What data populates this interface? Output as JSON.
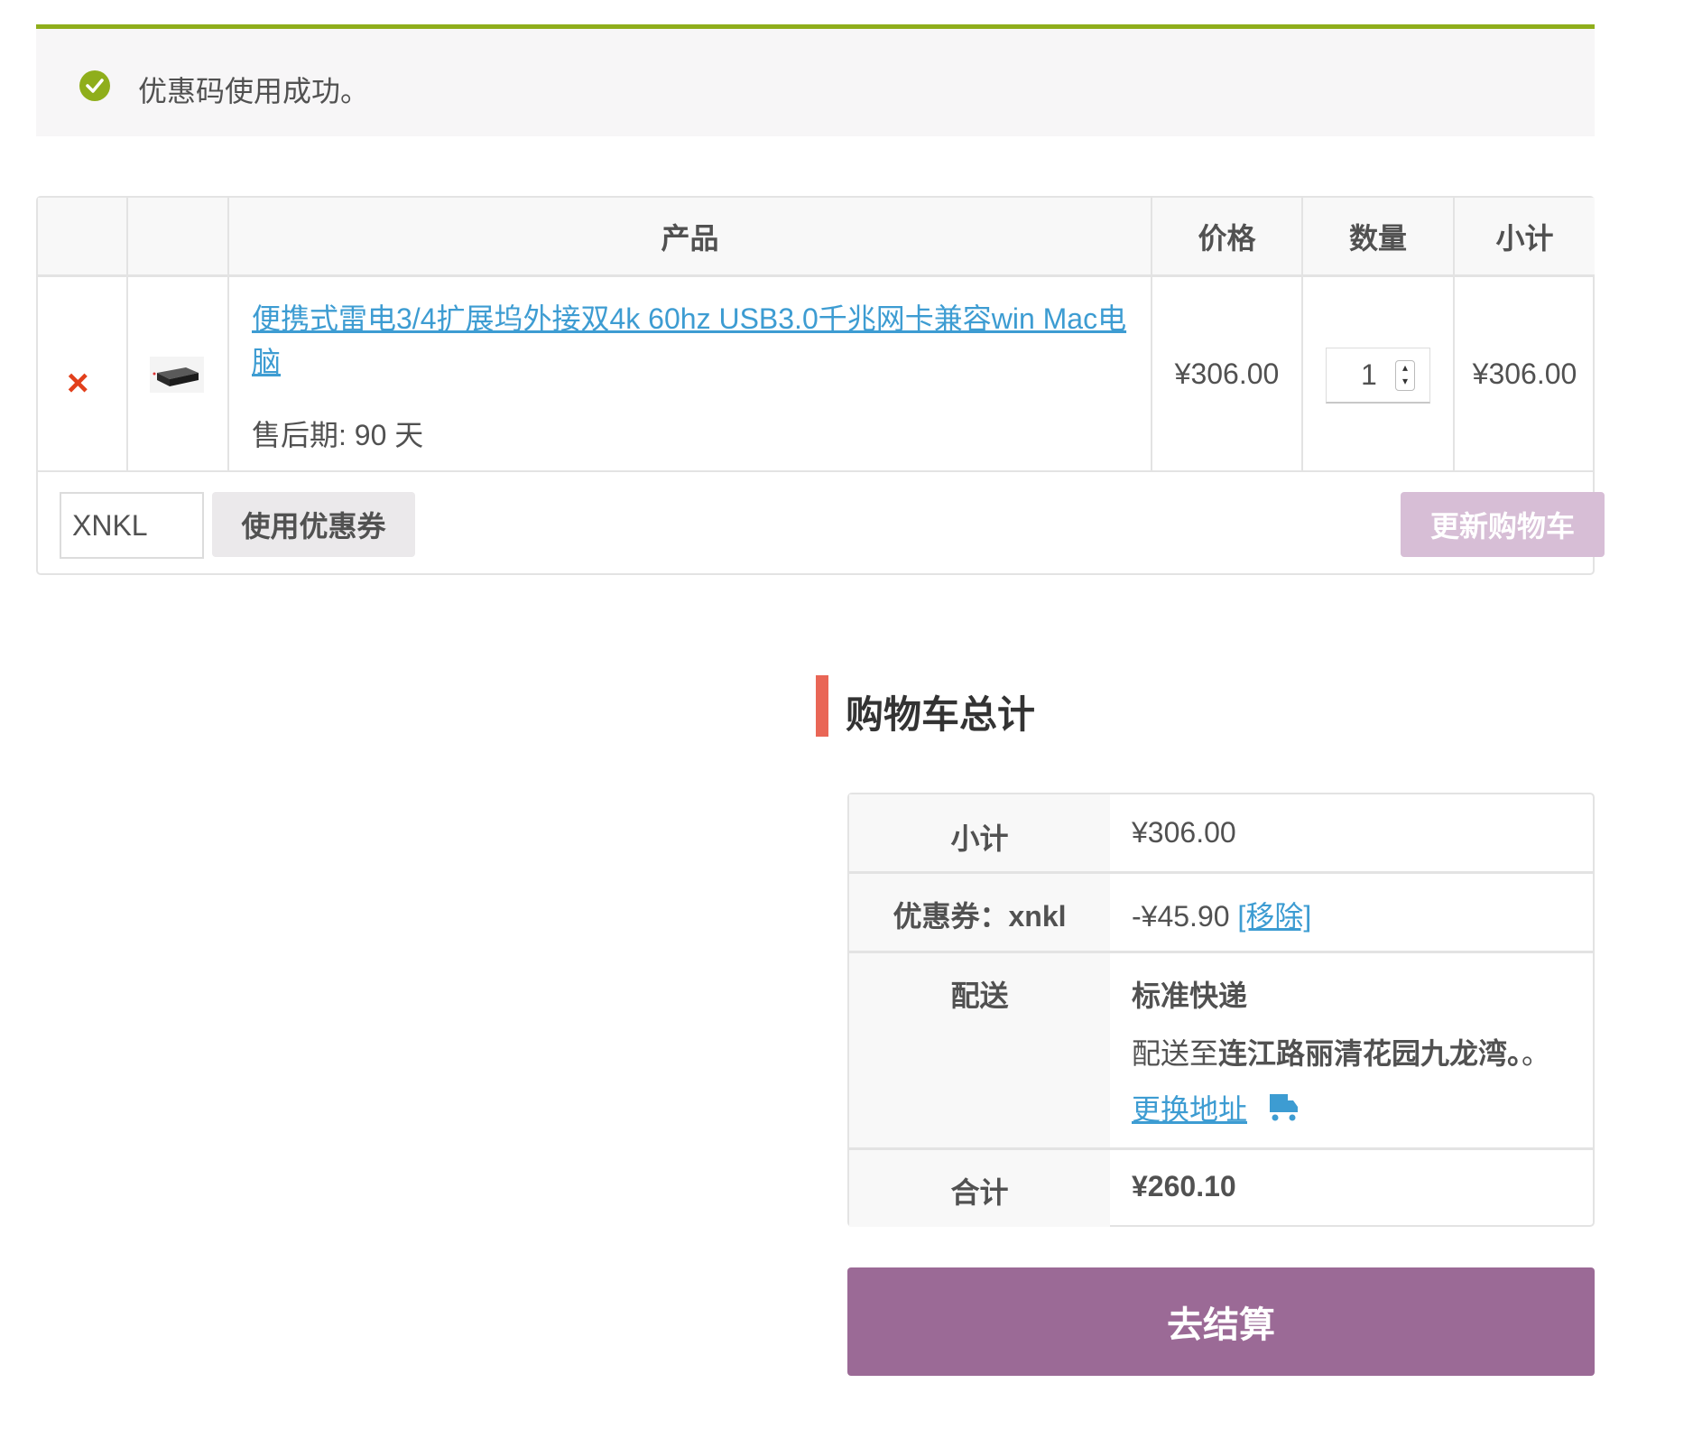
{
  "notice": {
    "message": "优惠码使用成功。",
    "icon": "check-circle-icon",
    "accent_color": "#8fae1b"
  },
  "cart": {
    "headers": {
      "product": "产品",
      "price": "价格",
      "quantity": "数量",
      "subtotal": "小计"
    },
    "item": {
      "remove_symbol": "×",
      "name": "便携式雷电3/4扩展坞外接双4k 60hz USB3.0千兆网卡兼容win Mac电脑",
      "meta": "售后期: 90 天",
      "price": "¥306.00",
      "quantity": "1",
      "subtotal": "¥306.00"
    },
    "coupon_code": "XNKL",
    "apply_coupon_label": "使用优惠券",
    "update_cart_label": "更新购物车"
  },
  "totals": {
    "title": "购物车总计",
    "subtotal_label": "小计",
    "subtotal_value": "¥306.00",
    "coupon_label": "优惠券：xnkl",
    "coupon_value": "-¥45.90",
    "coupon_remove": "[移除]",
    "shipping_label": "配送",
    "shipping_method": "标准快递",
    "shipping_to_prefix": "配送至",
    "shipping_to_address": "连江路丽清花园九龙湾。",
    "shipping_to_suffix": "。",
    "change_address": "更换地址",
    "total_label": "合计",
    "total_value": "¥260.10"
  },
  "checkout_label": "去结算",
  "colors": {
    "link": "#3d9cd2",
    "checkout": "#9b6a96",
    "update_disabled": "#d7bed6",
    "remove": "#e2401c",
    "title_bar": "#e96656"
  }
}
